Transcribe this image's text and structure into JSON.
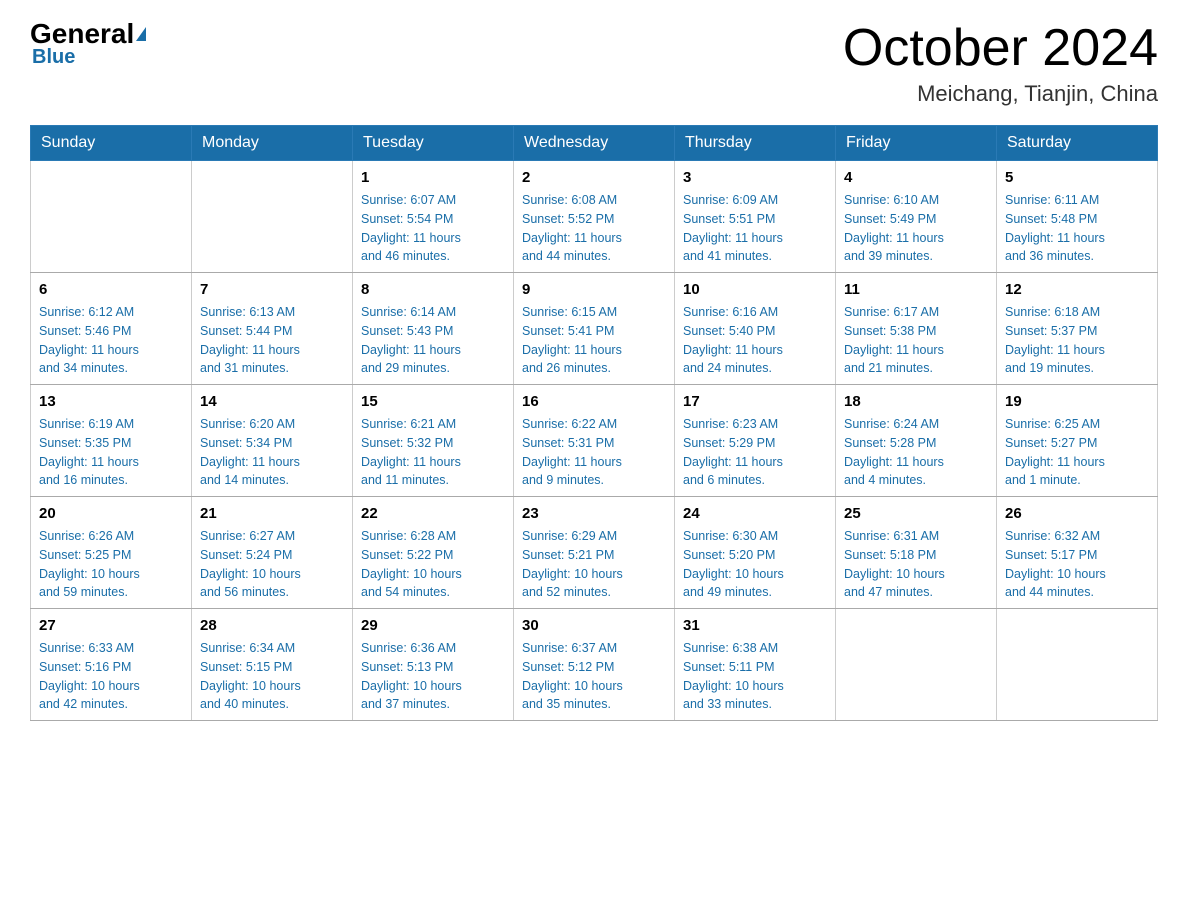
{
  "header": {
    "logo_general": "General",
    "logo_blue": "Blue",
    "title": "October 2024",
    "subtitle": "Meichang, Tianjin, China"
  },
  "days_of_week": [
    "Sunday",
    "Monday",
    "Tuesday",
    "Wednesday",
    "Thursday",
    "Friday",
    "Saturday"
  ],
  "weeks": [
    [
      {
        "day": "",
        "info": ""
      },
      {
        "day": "",
        "info": ""
      },
      {
        "day": "1",
        "info": "Sunrise: 6:07 AM\nSunset: 5:54 PM\nDaylight: 11 hours\nand 46 minutes."
      },
      {
        "day": "2",
        "info": "Sunrise: 6:08 AM\nSunset: 5:52 PM\nDaylight: 11 hours\nand 44 minutes."
      },
      {
        "day": "3",
        "info": "Sunrise: 6:09 AM\nSunset: 5:51 PM\nDaylight: 11 hours\nand 41 minutes."
      },
      {
        "day": "4",
        "info": "Sunrise: 6:10 AM\nSunset: 5:49 PM\nDaylight: 11 hours\nand 39 minutes."
      },
      {
        "day": "5",
        "info": "Sunrise: 6:11 AM\nSunset: 5:48 PM\nDaylight: 11 hours\nand 36 minutes."
      }
    ],
    [
      {
        "day": "6",
        "info": "Sunrise: 6:12 AM\nSunset: 5:46 PM\nDaylight: 11 hours\nand 34 minutes."
      },
      {
        "day": "7",
        "info": "Sunrise: 6:13 AM\nSunset: 5:44 PM\nDaylight: 11 hours\nand 31 minutes."
      },
      {
        "day": "8",
        "info": "Sunrise: 6:14 AM\nSunset: 5:43 PM\nDaylight: 11 hours\nand 29 minutes."
      },
      {
        "day": "9",
        "info": "Sunrise: 6:15 AM\nSunset: 5:41 PM\nDaylight: 11 hours\nand 26 minutes."
      },
      {
        "day": "10",
        "info": "Sunrise: 6:16 AM\nSunset: 5:40 PM\nDaylight: 11 hours\nand 24 minutes."
      },
      {
        "day": "11",
        "info": "Sunrise: 6:17 AM\nSunset: 5:38 PM\nDaylight: 11 hours\nand 21 minutes."
      },
      {
        "day": "12",
        "info": "Sunrise: 6:18 AM\nSunset: 5:37 PM\nDaylight: 11 hours\nand 19 minutes."
      }
    ],
    [
      {
        "day": "13",
        "info": "Sunrise: 6:19 AM\nSunset: 5:35 PM\nDaylight: 11 hours\nand 16 minutes."
      },
      {
        "day": "14",
        "info": "Sunrise: 6:20 AM\nSunset: 5:34 PM\nDaylight: 11 hours\nand 14 minutes."
      },
      {
        "day": "15",
        "info": "Sunrise: 6:21 AM\nSunset: 5:32 PM\nDaylight: 11 hours\nand 11 minutes."
      },
      {
        "day": "16",
        "info": "Sunrise: 6:22 AM\nSunset: 5:31 PM\nDaylight: 11 hours\nand 9 minutes."
      },
      {
        "day": "17",
        "info": "Sunrise: 6:23 AM\nSunset: 5:29 PM\nDaylight: 11 hours\nand 6 minutes."
      },
      {
        "day": "18",
        "info": "Sunrise: 6:24 AM\nSunset: 5:28 PM\nDaylight: 11 hours\nand 4 minutes."
      },
      {
        "day": "19",
        "info": "Sunrise: 6:25 AM\nSunset: 5:27 PM\nDaylight: 11 hours\nand 1 minute."
      }
    ],
    [
      {
        "day": "20",
        "info": "Sunrise: 6:26 AM\nSunset: 5:25 PM\nDaylight: 10 hours\nand 59 minutes."
      },
      {
        "day": "21",
        "info": "Sunrise: 6:27 AM\nSunset: 5:24 PM\nDaylight: 10 hours\nand 56 minutes."
      },
      {
        "day": "22",
        "info": "Sunrise: 6:28 AM\nSunset: 5:22 PM\nDaylight: 10 hours\nand 54 minutes."
      },
      {
        "day": "23",
        "info": "Sunrise: 6:29 AM\nSunset: 5:21 PM\nDaylight: 10 hours\nand 52 minutes."
      },
      {
        "day": "24",
        "info": "Sunrise: 6:30 AM\nSunset: 5:20 PM\nDaylight: 10 hours\nand 49 minutes."
      },
      {
        "day": "25",
        "info": "Sunrise: 6:31 AM\nSunset: 5:18 PM\nDaylight: 10 hours\nand 47 minutes."
      },
      {
        "day": "26",
        "info": "Sunrise: 6:32 AM\nSunset: 5:17 PM\nDaylight: 10 hours\nand 44 minutes."
      }
    ],
    [
      {
        "day": "27",
        "info": "Sunrise: 6:33 AM\nSunset: 5:16 PM\nDaylight: 10 hours\nand 42 minutes."
      },
      {
        "day": "28",
        "info": "Sunrise: 6:34 AM\nSunset: 5:15 PM\nDaylight: 10 hours\nand 40 minutes."
      },
      {
        "day": "29",
        "info": "Sunrise: 6:36 AM\nSunset: 5:13 PM\nDaylight: 10 hours\nand 37 minutes."
      },
      {
        "day": "30",
        "info": "Sunrise: 6:37 AM\nSunset: 5:12 PM\nDaylight: 10 hours\nand 35 minutes."
      },
      {
        "day": "31",
        "info": "Sunrise: 6:38 AM\nSunset: 5:11 PM\nDaylight: 10 hours\nand 33 minutes."
      },
      {
        "day": "",
        "info": ""
      },
      {
        "day": "",
        "info": ""
      }
    ]
  ]
}
